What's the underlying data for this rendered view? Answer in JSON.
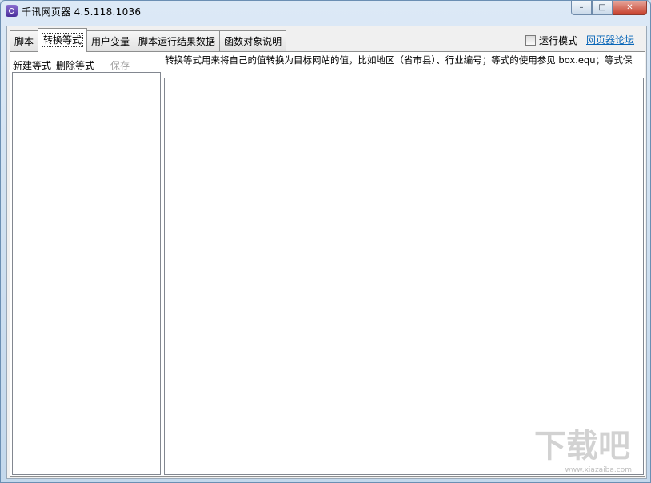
{
  "window": {
    "title": "千讯网页器  4.5.118.1036"
  },
  "controls": {
    "minimize": "–",
    "maximize": "□",
    "close": "✕"
  },
  "tabs": [
    {
      "label": "脚本"
    },
    {
      "label": "转换等式"
    },
    {
      "label": "用户变量"
    },
    {
      "label": "脚本运行结果数据"
    },
    {
      "label": "函数对象说明"
    }
  ],
  "active_tab": 1,
  "run_mode": {
    "label": "运行模式",
    "checked": false
  },
  "forum_link": "网页器论坛",
  "toolbar": {
    "new_label": "新建等式",
    "delete_label": "删除等式",
    "save_label": "保存"
  },
  "description": "转换等式用来将自己的值转换为目标网站的值，比如地区（省市县）、行业编号；等式的使用参见 box.equ；等式保",
  "watermark": {
    "text": "下载吧",
    "sub": "www.xiazaiba.com"
  }
}
